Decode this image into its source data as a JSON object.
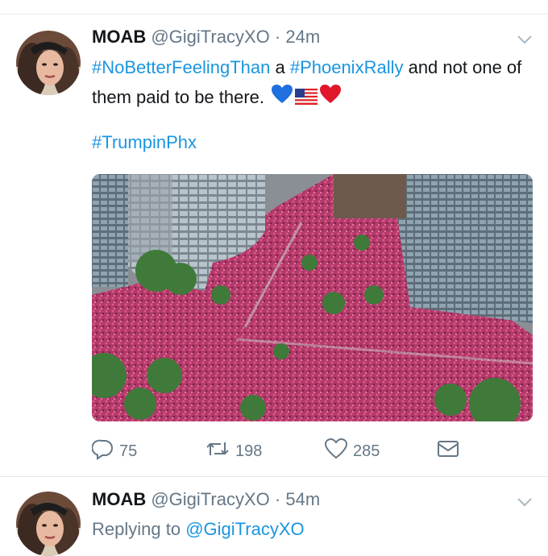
{
  "tweets": [
    {
      "name": "MOAB",
      "handle": "@GigiTracyXO",
      "separator": "·",
      "time": "24m",
      "text_parts": {
        "hashtag1": "#NoBetterFeelingThan",
        "t1": " a ",
        "hashtag2": "#PhoenixRally",
        "t2": " and not one of them paid to be there."
      },
      "hashtag3": "#TrumpinPhx",
      "emojis": [
        "blue-heart-icon",
        "us-flag-icon",
        "red-heart-icon"
      ],
      "actions": {
        "replies": "75",
        "retweets": "198",
        "likes": "285"
      }
    },
    {
      "name": "MOAB",
      "handle": "@GigiTracyXO",
      "separator": "·",
      "time": "54m",
      "replying_label": "Replying to ",
      "replying_to": "@GigiTracyXO"
    }
  ],
  "colors": {
    "link": "#1b95e0",
    "muted": "#657786",
    "text": "#14171a"
  }
}
